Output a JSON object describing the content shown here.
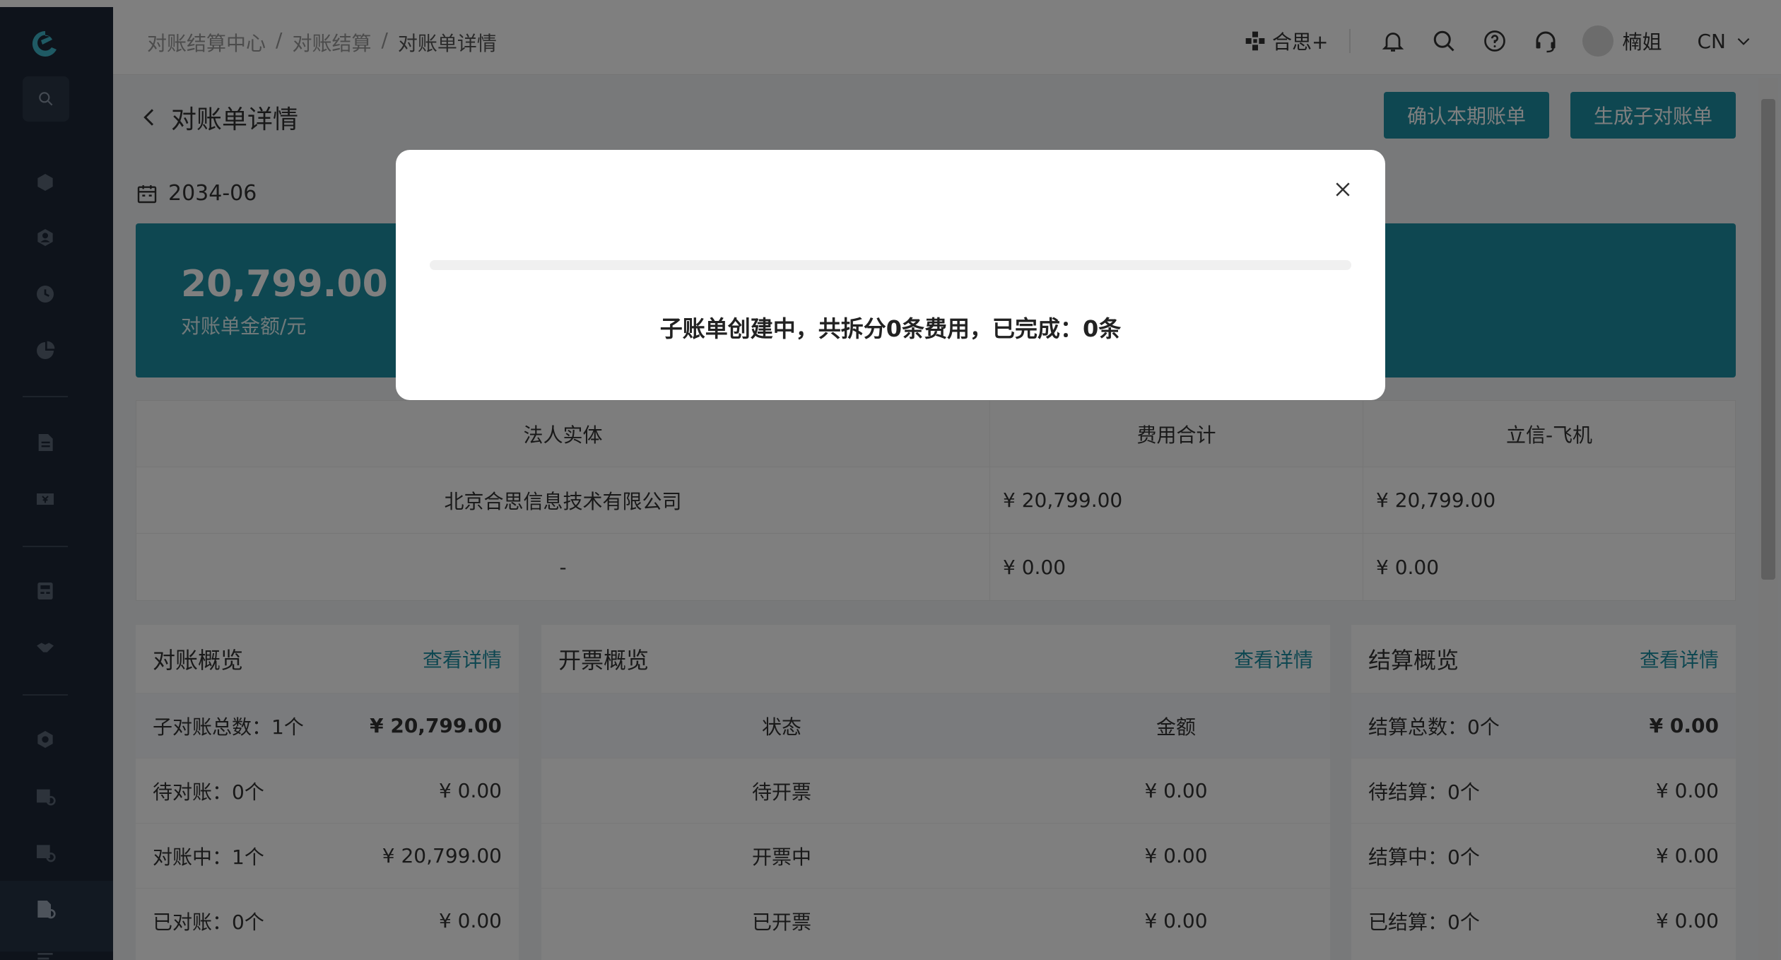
{
  "header": {
    "breadcrumb": [
      "对账结算中心",
      "对账结算",
      "对账单详情"
    ],
    "brand_label": "合思+",
    "user_name": "楠姐",
    "language": "CN"
  },
  "page": {
    "title": "对账单详情",
    "confirm_button": "确认本期账单",
    "generate_button": "生成子对账单",
    "period": "2034-06"
  },
  "summary": {
    "amount": "20,799.00",
    "amount_label": "对账单金额/元"
  },
  "entity_table": {
    "headers": [
      "法人实体",
      "费用合计",
      "立信-飞机"
    ],
    "rows": [
      [
        "北京合思信息技术有限公司",
        "¥ 20,799.00",
        "¥ 20,799.00"
      ],
      [
        "-",
        "¥ 0.00",
        "¥ 0.00"
      ]
    ]
  },
  "reconcile_overview": {
    "title": "对账概览",
    "link": "查看详情",
    "rows": [
      {
        "label": "子对账总数：1个",
        "value": "¥ 20,799.00"
      },
      {
        "label": "待对账：0个",
        "value": "¥ 0.00"
      },
      {
        "label": "对账中：1个",
        "value": "¥ 20,799.00"
      },
      {
        "label": "已对账：0个",
        "value": "¥ 0.00"
      }
    ]
  },
  "invoice_overview": {
    "title": "开票概览",
    "link": "查看详情",
    "col_status": "状态",
    "col_amount": "金额",
    "rows": [
      {
        "status": "待开票",
        "amount": "¥ 0.00"
      },
      {
        "status": "开票中",
        "amount": "¥ 0.00"
      },
      {
        "status": "已开票",
        "amount": "¥ 0.00"
      }
    ]
  },
  "settlement_overview": {
    "title": "结算概览",
    "link": "查看详情",
    "rows": [
      {
        "label": "结算总数：0个",
        "value": "¥ 0.00"
      },
      {
        "label": "待结算：0个",
        "value": "¥ 0.00"
      },
      {
        "label": "结算中：0个",
        "value": "¥ 0.00"
      },
      {
        "label": "已结算：0个",
        "value": "¥ 0.00"
      }
    ]
  },
  "modal": {
    "message": "子账单创建中，共拆分0条费用，已完成：0条",
    "progress": 0
  },
  "colors": {
    "accent": "#1d8fa3",
    "sidebar": "#1c2736"
  }
}
